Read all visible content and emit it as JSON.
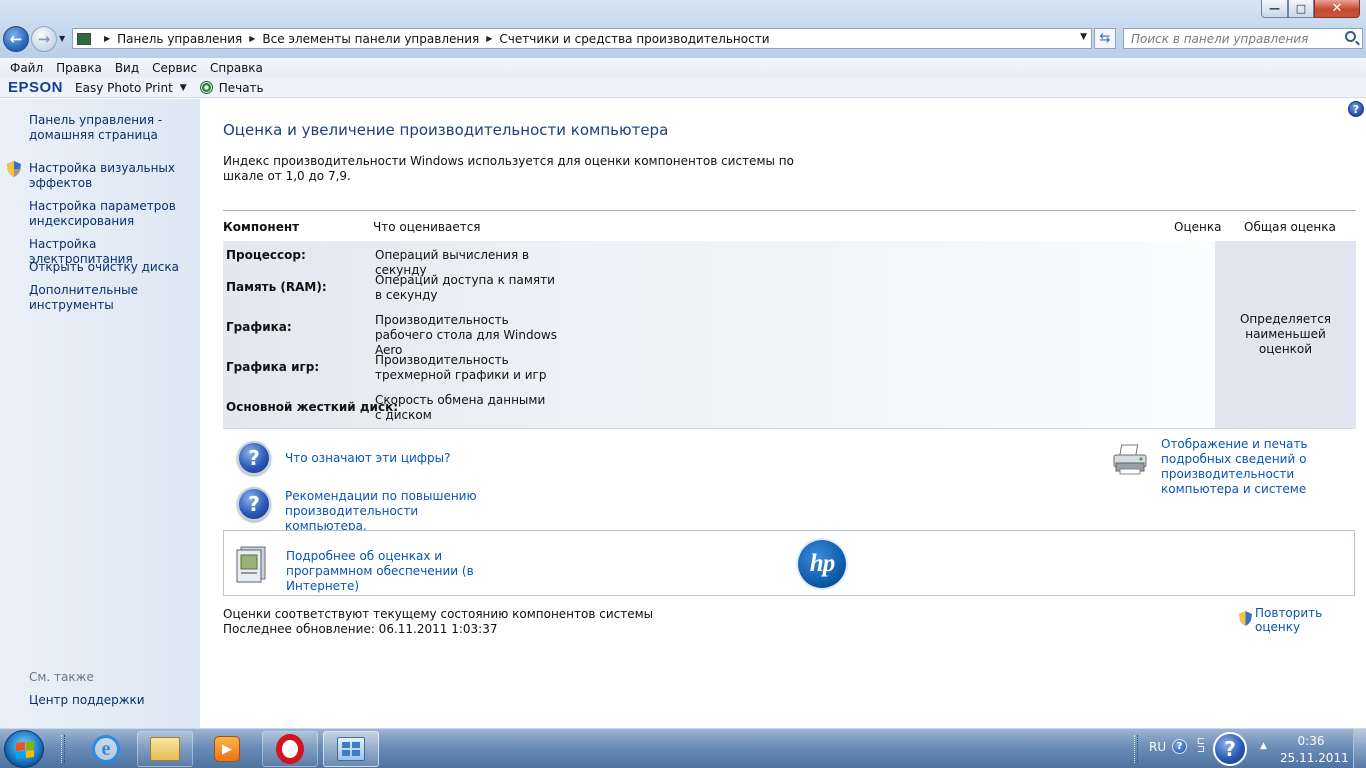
{
  "window": {
    "min_glyph": "—",
    "max_glyph": "□",
    "close_glyph": "✕"
  },
  "address": {
    "crumbs": [
      "Панель управления",
      "Все элементы панели управления",
      "Счетчики и средства производительности"
    ],
    "search_placeholder": "Поиск в панели управления"
  },
  "menu": [
    "Файл",
    "Правка",
    "Вид",
    "Сервис",
    "Справка"
  ],
  "epson_bar": {
    "logo": "EPSON",
    "app": "Easy Photo Print",
    "print": "Печать"
  },
  "sidebar": {
    "home": "Панель управления - домашняя страница",
    "items": [
      {
        "label": "Настройка визуальных эффектов",
        "icon": "shield-icon"
      },
      {
        "label": "Настройка параметров индексирования"
      },
      {
        "label": "Настройка электропитания"
      },
      {
        "label": "Открыть очистку диска"
      },
      {
        "label": "Дополнительные инструменты"
      }
    ],
    "see_also": "См. также",
    "support": "Центр поддержки"
  },
  "main": {
    "title": "Оценка и увеличение производительности компьютера",
    "intro": "Индекс производительности Windows используется для оценки компонентов системы по шкале от 1,0 до 7,9.",
    "table": {
      "headers": {
        "component": "Компонент",
        "what": "Что оценивается",
        "score": "Оценка",
        "overall": "Общая оценка"
      },
      "rows": [
        {
          "name": "Процессор:",
          "desc": "Операций вычисления в секунду"
        },
        {
          "name": "Память (RAM):",
          "desc": "Операций доступа к памяти в секунду"
        },
        {
          "name": "Графика:",
          "desc": "Производительность рабочего стола для Windows Aero"
        },
        {
          "name": "Графика игр:",
          "desc": "Производительность трехмерной графики и игр"
        },
        {
          "name": "Основной жесткий диск:",
          "desc": "Скорость обмена данными с диском"
        }
      ],
      "overall_text": "Определяется наименьшей оценкой"
    },
    "links": {
      "what_numbers": "Что означают эти цифры?",
      "tips": "Рекомендации по повышению производительности компьютера.",
      "print_details": "Отображение и печать подробных сведений о производительности компьютера и системе",
      "more_online": "Подробнее об оценках и программном обеспечении (в Интернете)"
    },
    "hp_logo": "hp",
    "status": {
      "line1": "Оценки соответствуют текущему состоянию компонентов системы",
      "line2": "Последнее обновление: 06.11.2011 1:03:37",
      "rerun": "Повторить оценку"
    }
  },
  "taskbar": {
    "lang": "RU",
    "time": "0:36",
    "date": "25.11.2011"
  }
}
